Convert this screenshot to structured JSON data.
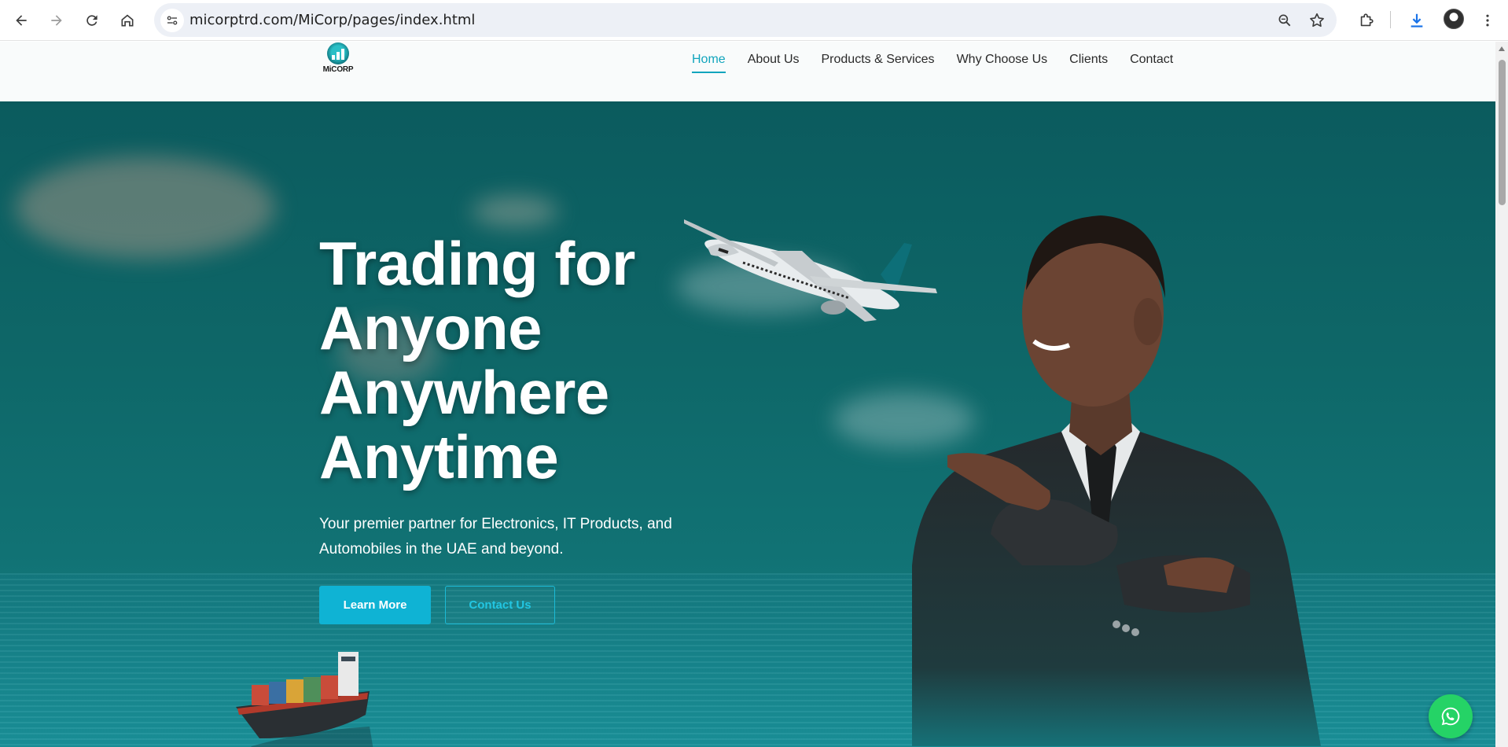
{
  "browser": {
    "url": "micorptrd.com/MiCorp/pages/index.html",
    "icons": [
      "back-arrow-icon",
      "forward-arrow-icon",
      "reload-icon",
      "home-icon",
      "site-info-icon",
      "zoom-icon",
      "bookmark-star-icon",
      "extensions-icon",
      "download-icon",
      "profile-avatar",
      "more-menu-icon"
    ]
  },
  "site": {
    "logo_text": "MiCORP",
    "nav": [
      {
        "label": "Home",
        "active": true
      },
      {
        "label": "About Us",
        "active": false
      },
      {
        "label": "Products & Services",
        "active": false
      },
      {
        "label": "Why Choose Us",
        "active": false
      },
      {
        "label": "Clients",
        "active": false
      },
      {
        "label": "Contact",
        "active": false
      }
    ]
  },
  "hero": {
    "title_lines": [
      "Trading for",
      "Anyone",
      "Anywhere",
      "Anytime"
    ],
    "subtitle": "Your premier partner for Electronics, IT Products, and Automobiles in the UAE and beyond.",
    "primary_button": "Learn More",
    "secondary_button": "Contact Us"
  },
  "floating": {
    "icon": "whatsapp-icon"
  },
  "colors": {
    "accent": "#12a5bd",
    "button_primary": "#0fb3d4",
    "hero_bg": "#0e6768",
    "whatsapp": "#25d366"
  }
}
